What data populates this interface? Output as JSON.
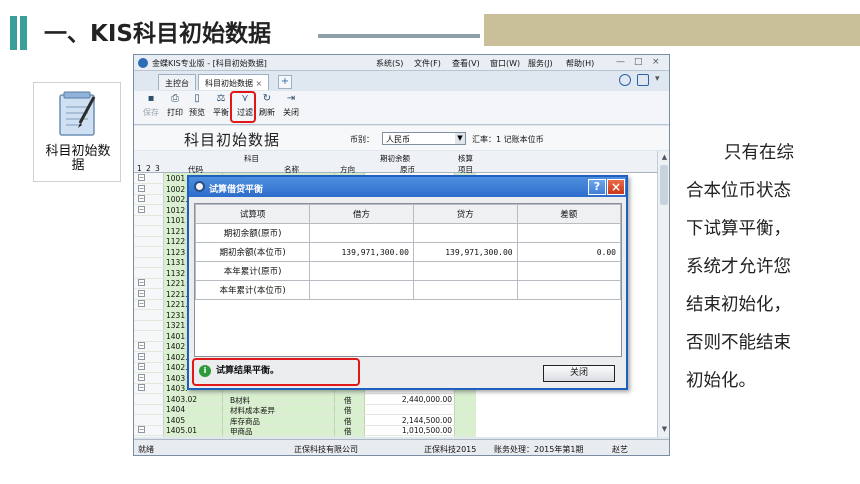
{
  "slide": {
    "title": "一、KIS科目初始数据",
    "icon_label_lines": [
      "科目初始数",
      "据"
    ],
    "description_lines": [
      "只有在综",
      "合本位币状态",
      "下试算平衡，",
      "系统才允许您",
      "结束初始化，",
      "否则不能结束",
      "初始化。"
    ]
  },
  "app": {
    "title": "金蝶KIS专业版 - [科目初始数据]",
    "menus": [
      "系统(S)",
      "文件(F)",
      "查看(V)",
      "窗口(W)",
      "服务(J)",
      "帮助(H)"
    ],
    "window_controls": [
      "—",
      "□",
      "×"
    ],
    "tabs": [
      {
        "label": "主控台",
        "active": false
      },
      {
        "label": "科目初始数据",
        "active": true
      }
    ],
    "tab_close": "×",
    "tab_add": "+",
    "toolbar": [
      {
        "label": "保存",
        "icon": "save-icon",
        "glyph": "▪",
        "enabled": false
      },
      {
        "label": "打印",
        "icon": "print-icon",
        "glyph": "⎙",
        "enabled": true
      },
      {
        "label": "预览",
        "icon": "preview-icon",
        "glyph": "▯",
        "enabled": true
      },
      {
        "label": "平衡",
        "icon": "balance-icon",
        "glyph": "⚖",
        "enabled": true
      },
      {
        "label": "过滤",
        "icon": "filter-icon",
        "glyph": "⋎",
        "enabled": true
      },
      {
        "label": "刷新",
        "icon": "refresh-icon",
        "glyph": "↻",
        "enabled": true
      },
      {
        "label": "关闭",
        "icon": "exit-icon",
        "glyph": "⇥",
        "enabled": true
      }
    ],
    "page_heading": "科目初始数据",
    "currency_label": "币别：",
    "currency_value": "人民币",
    "rate_text": "汇率：1  记账本位币",
    "grid": {
      "levels": [
        "1",
        "2",
        "3"
      ],
      "col_code": "代码",
      "col_subject": "科目",
      "col_name": "名称",
      "col_opening": "期初余额",
      "col_direction": "方向",
      "col_original": "原币",
      "col_check": "核算",
      "col_item": "项目",
      "rows": [
        {
          "expander": "⊟",
          "code": "1001",
          "name": "",
          "dir": "",
          "amount": ""
        },
        {
          "expander": "⊟",
          "code": "1002",
          "name": "",
          "dir": "",
          "amount": ""
        },
        {
          "expander": "⊟",
          "code": "1002.",
          "name": "",
          "dir": "",
          "amount": ""
        },
        {
          "expander": "⊟",
          "code": "1012",
          "name": "",
          "dir": "",
          "amount": ""
        },
        {
          "expander": "",
          "code": "1101",
          "name": "",
          "dir": "",
          "amount": ""
        },
        {
          "expander": "",
          "code": "1121",
          "name": "",
          "dir": "",
          "amount": ""
        },
        {
          "expander": "",
          "code": "1122",
          "name": "",
          "dir": "",
          "amount": ""
        },
        {
          "expander": "",
          "code": "1123",
          "name": "",
          "dir": "",
          "amount": ""
        },
        {
          "expander": "",
          "code": "1131",
          "name": "",
          "dir": "",
          "amount": ""
        },
        {
          "expander": "",
          "code": "1132",
          "name": "",
          "dir": "",
          "amount": ""
        },
        {
          "expander": "⊟",
          "code": "1221",
          "name": "",
          "dir": "",
          "amount": ""
        },
        {
          "expander": "⊟",
          "code": "1221.0",
          "name": "",
          "dir": "",
          "amount": ""
        },
        {
          "expander": "⊟",
          "code": "1221.0",
          "name": "",
          "dir": "",
          "amount": ""
        },
        {
          "expander": "",
          "code": "1231",
          "name": "",
          "dir": "",
          "amount": ""
        },
        {
          "expander": "",
          "code": "1321",
          "name": "",
          "dir": "",
          "amount": ""
        },
        {
          "expander": "",
          "code": "1401",
          "name": "",
          "dir": "",
          "amount": ""
        },
        {
          "expander": "⊟",
          "code": "1402",
          "name": "",
          "dir": "",
          "amount": ""
        },
        {
          "expander": "⊟",
          "code": "1402.0",
          "name": "",
          "dir": "",
          "amount": ""
        },
        {
          "expander": "⊟",
          "code": "1402.0",
          "name": "",
          "dir": "",
          "amount": ""
        },
        {
          "expander": "⊟",
          "code": "1403",
          "name": "",
          "dir": "",
          "amount": ""
        },
        {
          "expander": "⊟",
          "code": "1403.",
          "name": "",
          "dir": "",
          "amount": ""
        },
        {
          "expander": "",
          "code": "1403.02",
          "name": "B材料",
          "dir": "借",
          "amount": "2,440,000.00"
        },
        {
          "expander": "",
          "code": "1404",
          "name": "材料成本差异",
          "dir": "借",
          "amount": ""
        },
        {
          "expander": "",
          "code": "1405",
          "name": "库存商品",
          "dir": "借",
          "amount": "2,144,500.00"
        },
        {
          "expander": "⊟",
          "code": "1405.01",
          "name": "甲商品",
          "dir": "借",
          "amount": "1,010,500.00"
        }
      ]
    },
    "status": {
      "ready": "就绪",
      "company": "正保科技有限公司",
      "account_set": "正保科技2015",
      "period": "账务处理：2015年第1期",
      "user": "赵艺"
    }
  },
  "dialog": {
    "title": "试算借贷平衡",
    "help": "?",
    "close": "×",
    "columns": [
      "试算项",
      "借方",
      "贷方",
      "差额"
    ],
    "rows": [
      {
        "item": "期初余额(原币)",
        "debit": "",
        "credit": "",
        "diff": ""
      },
      {
        "item": "期初余额(本位币)",
        "debit": "139,971,300.00",
        "credit": "139,971,300.00",
        "diff": "0.00"
      },
      {
        "item": "本年累计(原币)",
        "debit": "",
        "credit": "",
        "diff": ""
      },
      {
        "item": "本年累计(本位币)",
        "debit": "",
        "credit": "",
        "diff": ""
      }
    ],
    "result_message": "试算结果平衡。",
    "ok_icon": "i",
    "close_button": "关闭"
  },
  "colors": {
    "accent_teal": "#3a9e9a",
    "highlight_red": "#e01818",
    "dialog_blue": "#2d6dcb",
    "grid_green": "#d9f0cf"
  }
}
